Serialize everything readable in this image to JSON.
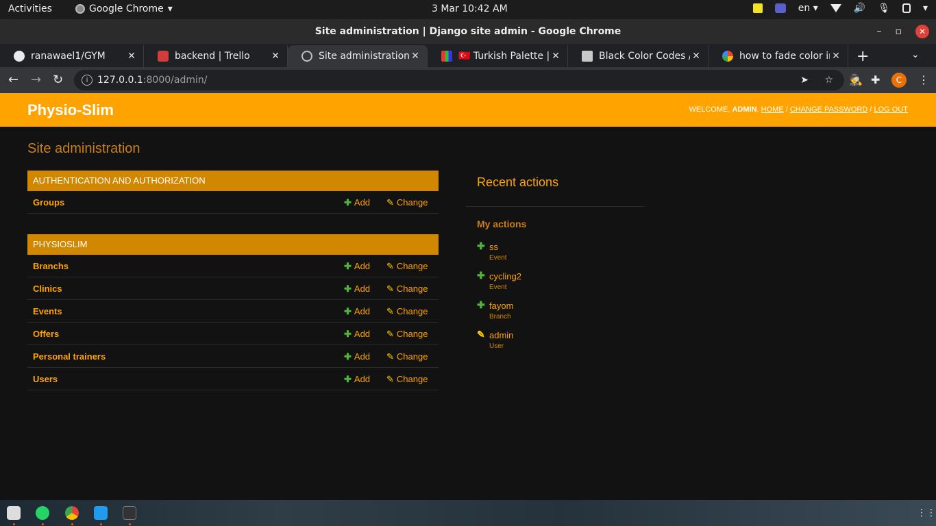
{
  "system_bar": {
    "activities": "Activities",
    "app_name": "Google Chrome",
    "clock": "3 Mar  10:42 AM",
    "language": "en"
  },
  "window": {
    "title": "Site administration | Django site admin - Google Chrome"
  },
  "tabs": [
    {
      "label": "ranawael1/GYM",
      "favicon": "github-icon"
    },
    {
      "label": "backend | Trello",
      "favicon": "trello-icon"
    },
    {
      "label": "Site administration | D",
      "favicon": "globe-icon"
    },
    {
      "label": "🇹🇷 Turkish Palette | F",
      "favicon": "palette-icon"
    },
    {
      "label": "Black Color Codes / S",
      "favicon": "color-icon"
    },
    {
      "label": "how to fade color in",
      "favicon": "google-icon"
    }
  ],
  "address_bar": {
    "host": "127.0.0.1",
    "path": ":8000/admin/"
  },
  "profile_initial": "C",
  "admin": {
    "brand": "Physio-Slim",
    "user_tools": {
      "welcome": "WELCOME,",
      "user": "ADMIN",
      "home": "HOME",
      "change_password": "CHANGE PASSWORD",
      "logout": "LOG OUT"
    },
    "page_title": "Site administration",
    "apps": [
      {
        "caption": "Authentication and Authorization",
        "models": [
          {
            "name": "Groups",
            "add": "Add",
            "change": "Change"
          }
        ]
      },
      {
        "caption": "Physioslim",
        "models": [
          {
            "name": "Branchs",
            "add": "Add",
            "change": "Change"
          },
          {
            "name": "Clinics",
            "add": "Add",
            "change": "Change"
          },
          {
            "name": "Events",
            "add": "Add",
            "change": "Change"
          },
          {
            "name": "Offers",
            "add": "Add",
            "change": "Change"
          },
          {
            "name": "Personal trainers",
            "add": "Add",
            "change": "Change"
          },
          {
            "name": "Users",
            "add": "Add",
            "change": "Change"
          }
        ]
      }
    ],
    "recent": {
      "title": "Recent actions",
      "subtitle": "My actions",
      "actions": [
        {
          "name": "ss",
          "type": "Event",
          "kind": "add"
        },
        {
          "name": "cycling2",
          "type": "Event",
          "kind": "add"
        },
        {
          "name": "fayom",
          "type": "Branch",
          "kind": "add"
        },
        {
          "name": "admin",
          "type": "User",
          "kind": "change"
        }
      ]
    }
  },
  "colors": {
    "header": "#ffa300",
    "module_caption": "#d18700",
    "link": "#ffa300",
    "add_icon": "#4fb53c",
    "background": "#121212"
  }
}
